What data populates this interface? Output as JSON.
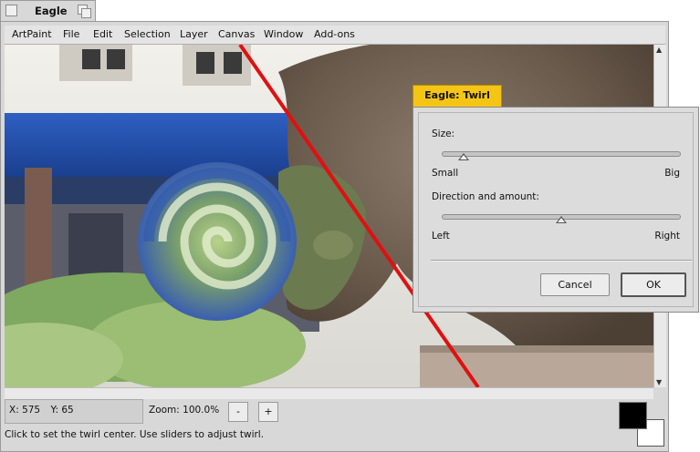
{
  "window": {
    "title": "Eagle"
  },
  "menu": [
    "ArtPaint",
    "File",
    "Edit",
    "Selection",
    "Layer",
    "Canvas",
    "Window",
    "Add-ons"
  ],
  "status": {
    "x_label": "X: 575",
    "y_label": "Y: 65",
    "zoom_label": "Zoom: 100.0%",
    "zoom_out": "-",
    "zoom_in": "+",
    "hint": "Click to set the twirl center. Use sliders to adjust twirl."
  },
  "colors": {
    "foreground": "#000000",
    "background": "#ffffff",
    "dialog_tab": "#f5c516",
    "line": "#e01010"
  },
  "dialog": {
    "title": "Eagle: Twirl",
    "size_label": "Size:",
    "size_min": "Small",
    "size_max": "Big",
    "size_value": 0.09,
    "direction_label": "Direction and amount:",
    "direction_min": "Left",
    "direction_max": "Right",
    "direction_value": 0.5,
    "cancel": "Cancel",
    "ok": "OK"
  }
}
